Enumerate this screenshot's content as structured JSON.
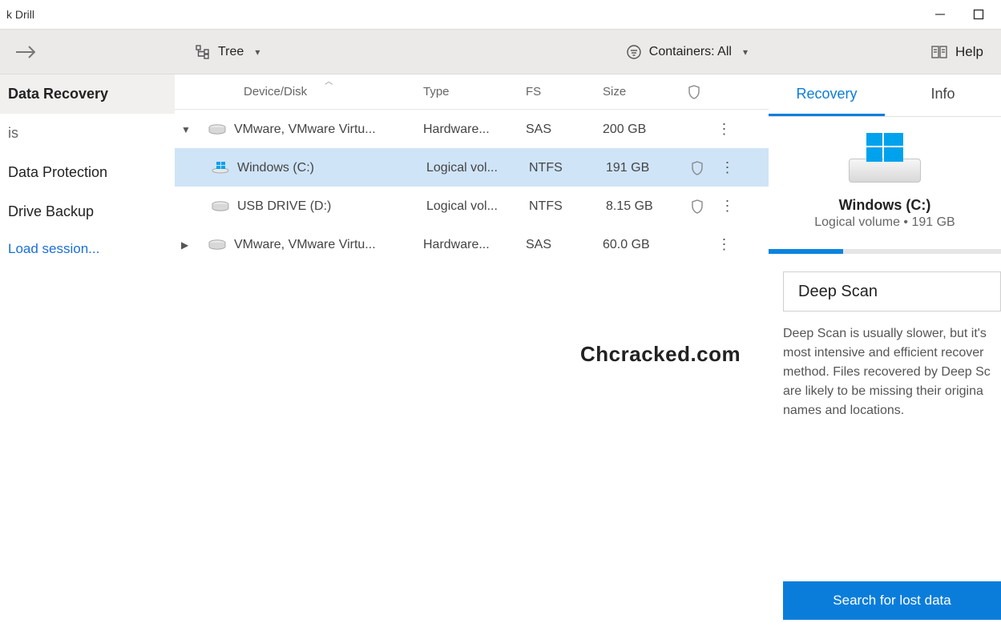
{
  "window": {
    "title": "k Drill"
  },
  "sidebar": {
    "items": [
      {
        "label": "Data Recovery",
        "active": true
      },
      {
        "label": "is",
        "sub": true
      },
      {
        "label": "Data Protection"
      },
      {
        "label": "Drive Backup"
      }
    ],
    "load_session": "Load session..."
  },
  "toolbar": {
    "tree_label": "Tree",
    "containers_label": "Containers: All",
    "help_label": "Help"
  },
  "columns": {
    "device": "Device/Disk",
    "type": "Type",
    "fs": "FS",
    "size": "Size"
  },
  "rows": [
    {
      "expander": "▼",
      "icon": "hdd",
      "name": "VMware, VMware Virtu...",
      "type": "Hardware...",
      "fs": "SAS",
      "size": "200 GB",
      "shield": false,
      "indent": 0
    },
    {
      "expander": "",
      "icon": "win",
      "name": "Windows (C:)",
      "type": "Logical vol...",
      "fs": "NTFS",
      "size": "191 GB",
      "shield": true,
      "indent": 1,
      "selected": true
    },
    {
      "expander": "",
      "icon": "hdd",
      "name": "USB DRIVE (D:)",
      "type": "Logical vol...",
      "fs": "NTFS",
      "size": "8.15 GB",
      "shield": true,
      "indent": 1
    },
    {
      "expander": "▶",
      "icon": "hdd",
      "name": "VMware, VMware Virtu...",
      "type": "Hardware...",
      "fs": "SAS",
      "size": "60.0 GB",
      "shield": false,
      "indent": 0
    }
  ],
  "watermark": "Chcracked.com",
  "right": {
    "tabs": {
      "recovery": "Recovery",
      "info": "Info"
    },
    "device_title": "Windows (C:)",
    "device_sub": "Logical volume • 191 GB",
    "progress_pct": 32,
    "scan_mode": "Deep Scan",
    "scan_desc": "Deep Scan is usually slower, but it's most intensive and efficient recover method. Files recovered by Deep Sc are likely to be missing their origina names and locations.",
    "search_button": "Search for lost data"
  }
}
